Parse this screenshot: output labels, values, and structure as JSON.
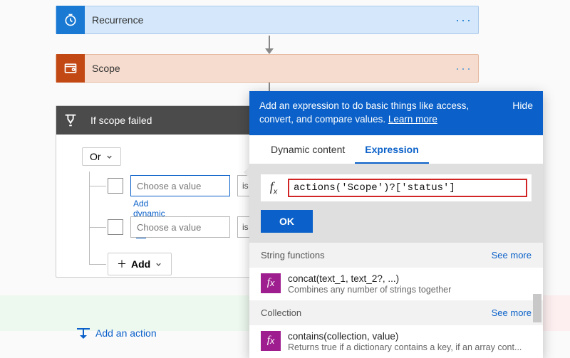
{
  "cards": {
    "recurrence": {
      "title": "Recurrence"
    },
    "scope": {
      "title": "Scope"
    }
  },
  "condition": {
    "title": "If scope failed",
    "operator": "Or",
    "rows": [
      {
        "placeholder": "Choose a value",
        "op": "is eq"
      },
      {
        "placeholder": "Choose a value",
        "op": "is eq"
      }
    ],
    "add_dynamic": "Add dynamic content",
    "add_label": "Add"
  },
  "add_action": "Add an action",
  "panel": {
    "tip": "Add an expression to do basic things like access, convert, and compare values.",
    "learn_more": "Learn more",
    "hide": "Hide",
    "tabs": {
      "dynamic": "Dynamic content",
      "expression": "Expression"
    },
    "fx": "actions('Scope')?['status']",
    "ok": "OK",
    "see_more": "See more",
    "cats": [
      {
        "name": "String functions",
        "fn": {
          "sig": "concat(text_1, text_2?, ...)",
          "desc": "Combines any number of strings together"
        }
      },
      {
        "name": "Collection",
        "fn": {
          "sig": "contains(collection, value)",
          "desc": "Returns true if a dictionary contains a key, if an array cont..."
        }
      }
    ]
  }
}
